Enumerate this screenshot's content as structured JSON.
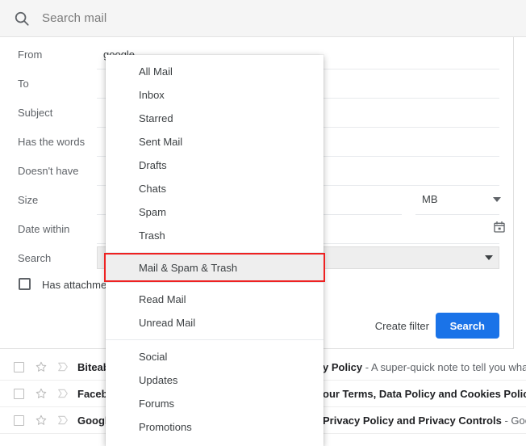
{
  "searchbar": {
    "icon": "search-icon",
    "placeholder": "Search mail"
  },
  "form": {
    "rows": [
      {
        "label": "From",
        "value": "google"
      },
      {
        "label": "To",
        "value": ""
      },
      {
        "label": "Subject",
        "value": ""
      },
      {
        "label": "Has the words",
        "value": ""
      },
      {
        "label": "Doesn't have",
        "value": ""
      }
    ],
    "size": {
      "label": "Size",
      "value": "",
      "unit": "MB",
      "caret_icon": "chevron-down-icon"
    },
    "date_within": {
      "label": "Date within",
      "value": "",
      "calendar_icon": "calendar-icon"
    },
    "scope": {
      "label": "Search",
      "value": "",
      "caret_icon": "chevron-down-icon"
    },
    "attachment": {
      "label": "Has attachment",
      "checked": false,
      "checkbox_icon": "checkbox-unchecked-icon"
    }
  },
  "actions": {
    "create_filter_label": "Create filter",
    "search_label": "Search",
    "search_button_color": "#1a73e8"
  },
  "dropdown": {
    "highlight_color": "#ee2222",
    "selected": "Mail & Spam & Trash",
    "groups": [
      {
        "items": [
          "All Mail",
          "Inbox",
          "Starred",
          "Sent Mail",
          "Drafts",
          "Chats",
          "Spam",
          "Trash"
        ]
      },
      {
        "items": [
          "Read Mail",
          "Unread Mail"
        ]
      },
      {
        "items": [
          "Social",
          "Updates",
          "Forums",
          "Promotions"
        ]
      }
    ]
  },
  "maillist": {
    "rows": [
      {
        "checkbox_icon": "checkbox-unchecked-icon",
        "star_icon": "star-outline-icon",
        "important_icon": "important-marker-icon",
        "sender": "Biteab",
        "subject": "y Policy",
        "snippet": " - A super-quick note to tell you wha"
      },
      {
        "checkbox_icon": "checkbox-unchecked-icon",
        "star_icon": "star-outline-icon",
        "important_icon": "important-marker-icon",
        "sender": "Faceb",
        "subject": "our Terms, Data Policy and Cookies Policy",
        "snippet": ""
      },
      {
        "checkbox_icon": "checkbox-unchecked-icon",
        "star_icon": "star-outline-icon",
        "important_icon": "important-marker-icon",
        "sender": "Googl",
        "subject": "Privacy Policy and Privacy Controls",
        "snippet": " - Googl"
      }
    ]
  }
}
